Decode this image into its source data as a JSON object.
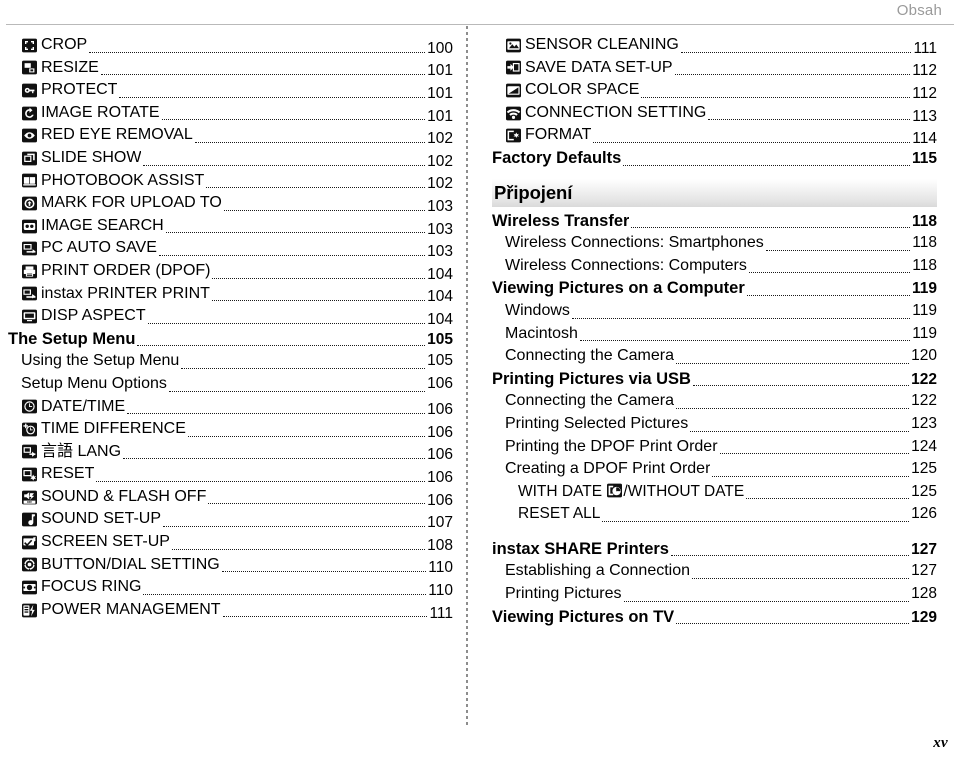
{
  "header": {
    "running_head": "Obsah"
  },
  "footer": {
    "folio": "xv"
  },
  "left_column": {
    "entries": [
      {
        "icon": "crop-icon",
        "text": "CROP",
        "page": "100",
        "level": "item"
      },
      {
        "icon": "resize-icon",
        "text": "RESIZE",
        "page": "101",
        "level": "item"
      },
      {
        "icon": "protect-key-icon",
        "text": "PROTECT",
        "page": "101",
        "level": "item"
      },
      {
        "icon": "image-rotate-icon",
        "text": "IMAGE ROTATE",
        "page": "101",
        "level": "item"
      },
      {
        "icon": "red-eye-removal-icon",
        "text": "RED EYE REMOVAL",
        "page": "102",
        "level": "item"
      },
      {
        "icon": "slide-show-icon",
        "text": "SLIDE SHOW",
        "page": "102",
        "level": "item"
      },
      {
        "icon": "photobook-icon",
        "text": "PHOTOBOOK ASSIST",
        "page": "102",
        "level": "item"
      },
      {
        "icon": "mark-upload-icon",
        "text": "MARK FOR UPLOAD TO",
        "page": "103",
        "level": "item"
      },
      {
        "icon": "image-search-icon",
        "text": "IMAGE SEARCH",
        "page": "103",
        "level": "item"
      },
      {
        "icon": "pc-auto-save-icon",
        "text": "PC AUTO SAVE",
        "page": "103",
        "level": "item"
      },
      {
        "icon": "print-order-icon",
        "text": "PRINT ORDER (DPOF)",
        "page": "104",
        "level": "item"
      },
      {
        "icon": "instax-printer-icon",
        "text": "instax PRINTER PRINT",
        "page": "104",
        "level": "item"
      },
      {
        "icon": "disp-aspect-icon",
        "text": "DISP ASPECT",
        "page": "104",
        "level": "item"
      },
      {
        "icon": null,
        "text": "The Setup Menu",
        "page": "105",
        "level": "h1"
      },
      {
        "icon": null,
        "text": "Using the Setup Menu",
        "page": "105",
        "level": "h2"
      },
      {
        "icon": null,
        "text": "Setup Menu Options",
        "page": "106",
        "level": "h2"
      },
      {
        "icon": "date-time-icon",
        "text": "DATE/TIME",
        "page": "106",
        "level": "item"
      },
      {
        "icon": "time-difference-icon",
        "text": "TIME DIFFERENCE",
        "page": "106",
        "level": "item"
      },
      {
        "icon": "language-icon",
        "text": "言語 LANG",
        "page": "106",
        "level": "item"
      },
      {
        "icon": "reset-icon",
        "text": "RESET",
        "page": "106",
        "level": "item"
      },
      {
        "icon": "sound-flash-off-icon",
        "text": "SOUND & FLASH OFF",
        "page": "106",
        "level": "item"
      },
      {
        "icon": "sound-setup-icon",
        "text": "SOUND SET-UP",
        "page": "107",
        "level": "item"
      },
      {
        "icon": "screen-setup-icon",
        "text": "SCREEN SET-UP",
        "page": "108",
        "level": "item"
      },
      {
        "icon": "button-dial-icon",
        "text": "BUTTON/DIAL SETTING",
        "page": "110",
        "level": "item"
      },
      {
        "icon": "focus-ring-icon",
        "text": "FOCUS RING",
        "page": "110",
        "level": "item"
      },
      {
        "icon": "power-management-icon",
        "text": "POWER MANAGEMENT",
        "page": "111",
        "level": "item"
      }
    ]
  },
  "right_column": {
    "entries_before_section": [
      {
        "icon": "sensor-cleaning-icon",
        "text": "SENSOR CLEANING",
        "page": "111",
        "level": "item"
      },
      {
        "icon": "save-data-setup-icon",
        "text": "SAVE DATA SET-UP",
        "page": "112",
        "level": "item"
      },
      {
        "icon": "color-space-icon",
        "text": "COLOR SPACE",
        "page": "112",
        "level": "item"
      },
      {
        "icon": "connection-setting-icon",
        "text": "CONNECTION SETTING",
        "page": "113",
        "level": "item"
      },
      {
        "icon": "format-icon",
        "text": "FORMAT",
        "page": "114",
        "level": "item"
      },
      {
        "icon": null,
        "text": "Factory Defaults",
        "page": "115",
        "level": "h1"
      }
    ],
    "section": {
      "title": "Připojení"
    },
    "entries_after_section": [
      {
        "text": "Wireless Transfer",
        "page": "118",
        "level": "h1"
      },
      {
        "text": "Wireless Connections: Smartphones",
        "page": "118",
        "level": "h2"
      },
      {
        "text": "Wireless Connections: Computers",
        "page": "118",
        "level": "h2"
      },
      {
        "text": "Viewing Pictures on a Computer",
        "page": "119",
        "level": "h1"
      },
      {
        "text": "Windows",
        "page": "119",
        "level": "h2"
      },
      {
        "text": "Macintosh",
        "page": "119",
        "level": "h2"
      },
      {
        "text": "Connecting the Camera",
        "page": "120",
        "level": "h2"
      },
      {
        "text": "Printing Pictures via USB",
        "page": "122",
        "level": "h1"
      },
      {
        "text": "Connecting the Camera",
        "page": "122",
        "level": "h2"
      },
      {
        "text": "Printing Selected Pictures",
        "page": "123",
        "level": "h2"
      },
      {
        "text": "Printing the DPOF Print Order",
        "page": "124",
        "level": "h2"
      },
      {
        "text": "Creating a DPOF Print Order",
        "page": "125",
        "level": "h2"
      },
      {
        "text": "WITH DATE ⟦date-stamp-icon⟧/WITHOUT DATE",
        "page": "125",
        "level": "h3",
        "inline_icon": "date-stamp-icon"
      },
      {
        "text": "RESET ALL",
        "page": "126",
        "level": "h3"
      },
      {
        "text": "instax SHARE Printers",
        "page": "127",
        "level": "h1"
      },
      {
        "text": "Establishing a Connection",
        "page": "127",
        "level": "h2"
      },
      {
        "text": "Printing Pictures",
        "page": "128",
        "level": "h2"
      },
      {
        "text": "Viewing Pictures on TV",
        "page": "129",
        "level": "h1"
      }
    ]
  },
  "colors": {
    "text": "#000000",
    "running_head": "#9a9a9a",
    "rule": "#b9b9b9",
    "section_band_top": "#ffffff",
    "section_band_bottom": "#d9d9d9",
    "icon_bg": "#101010",
    "icon_fg": "#ffffff"
  }
}
